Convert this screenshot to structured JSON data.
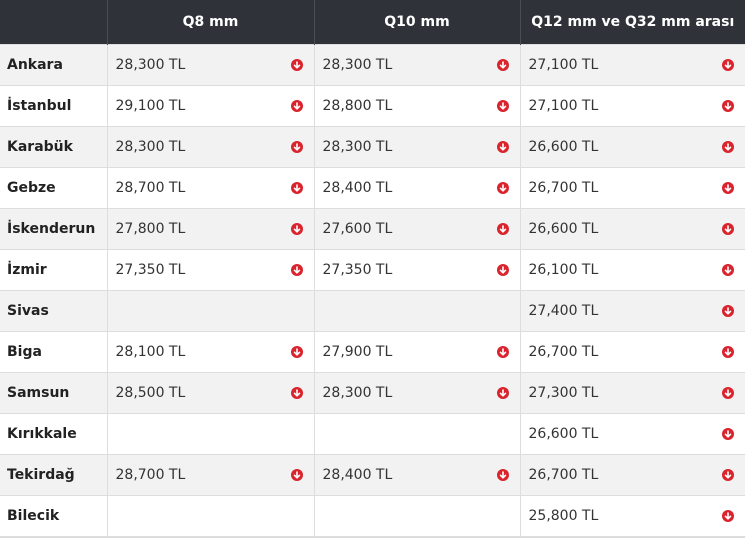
{
  "table": {
    "headers": [
      "",
      "Q8 mm",
      "Q10 mm",
      "Q12 mm ve Q32 mm arası"
    ],
    "trend_icon": "arrow-down-circle-icon",
    "trend_color": "#d9232d",
    "rows": [
      {
        "city": "Ankara",
        "q8": "28,300 TL",
        "q10": "28,300 TL",
        "q12_q32": "27,100 TL"
      },
      {
        "city": "İstanbul",
        "q8": "29,100 TL",
        "q10": "28,800 TL",
        "q12_q32": "27,100 TL"
      },
      {
        "city": "Karabük",
        "q8": "28,300 TL",
        "q10": "28,300 TL",
        "q12_q32": "26,600 TL"
      },
      {
        "city": "Gebze",
        "q8": "28,700 TL",
        "q10": "28,400 TL",
        "q12_q32": "26,700 TL"
      },
      {
        "city": "İskenderun",
        "q8": "27,800 TL",
        "q10": "27,600 TL",
        "q12_q32": "26,600 TL"
      },
      {
        "city": "İzmir",
        "q8": "27,350 TL",
        "q10": "27,350 TL",
        "q12_q32": "26,100 TL"
      },
      {
        "city": "Sivas",
        "q8": "",
        "q10": "",
        "q12_q32": "27,400 TL"
      },
      {
        "city": "Biga",
        "q8": "28,100 TL",
        "q10": "27,900 TL",
        "q12_q32": "26,700 TL"
      },
      {
        "city": "Samsun",
        "q8": "28,500 TL",
        "q10": "28,300 TL",
        "q12_q32": "27,300 TL"
      },
      {
        "city": "Kırıkkale",
        "q8": "",
        "q10": "",
        "q12_q32": "26,600 TL"
      },
      {
        "city": "Tekirdağ",
        "q8": "28,700 TL",
        "q10": "28,400 TL",
        "q12_q32": "26,700 TL"
      },
      {
        "city": "Bilecik",
        "q8": "",
        "q10": "",
        "q12_q32": "25,800 TL"
      }
    ]
  }
}
